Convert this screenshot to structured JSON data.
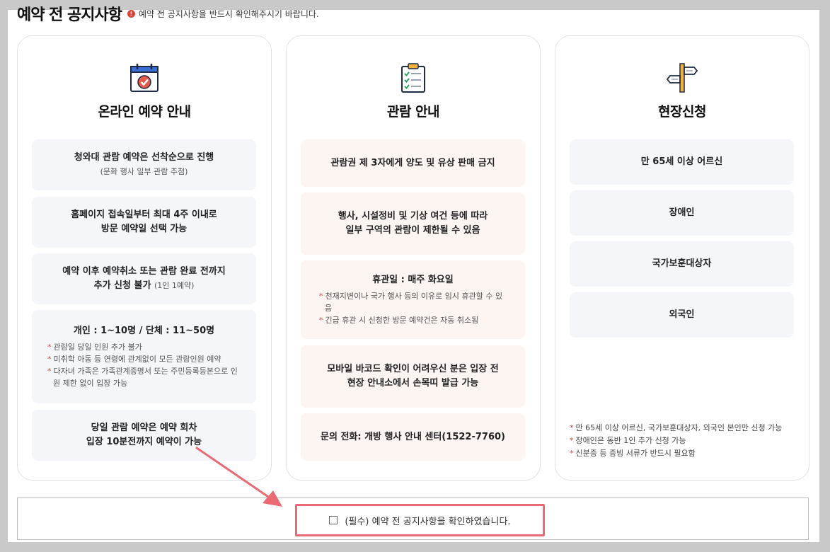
{
  "header": {
    "title": "예약 전 공지사항",
    "notice_icon": "!",
    "notice": "예약 전 공지사항을 반드시 확인해주시기 바랍니다."
  },
  "cards": [
    {
      "icon": "calendar-check-icon",
      "title": "온라인 예약 안내",
      "boxes": [
        {
          "text": "청와대 관람 예약은 선착순으로 진행",
          "sub": "(문화 행사 일부 관람 추첨)"
        },
        {
          "line1": "홈페이지 접속일부터 최대 4주 이내로",
          "line2": "방문 예약일 선택 가능"
        },
        {
          "line1": "예약 이후 예약취소 또는 관람 완료 전까지",
          "line2": "추가 신청 불가",
          "sub": "(1인 1예약)"
        },
        {
          "text": "개인 : 1~10명 / 단체 : 11~50명",
          "notes": [
            "관람일 당일 인원 추가 불가",
            "미취학 아동 등 연령에 관계없이 모든 관람인원 예약",
            "다자녀 가족은 가족관계증명서 또는 주민등록등본으로 인원 제한 없이 입장 가능"
          ]
        },
        {
          "line1": "당일 관람 예약은 예약 회차",
          "line2": "입장 10분전까지 예약이 가능"
        }
      ]
    },
    {
      "icon": "clipboard-checklist-icon",
      "title": "관람 안내",
      "boxes": [
        {
          "text": "관람권 제 3자에게 양도 및 유상 판매 금지"
        },
        {
          "line1": "행사, 시설정비 및 기상 여건 등에 따라",
          "line2": "일부 구역의 관람이 제한될 수 있음"
        },
        {
          "text": "휴관일 : 매주 화요일",
          "notes": [
            "천재지변이나 국가 행사 등의 이유로 임시 휴관할 수 있음",
            "긴급 휴관 시 신청한 방문 예약건은 자동 취소됨"
          ]
        },
        {
          "line1": "모바일 바코드 확인이 어려우신 분은 입장 전",
          "line2": "현장 안내소에서 손목띠 발급 가능"
        },
        {
          "text": "문의 전화: 개방 행사 안내 센터(1522-7760)"
        }
      ]
    },
    {
      "icon": "signpost-icon",
      "title": "현장신청",
      "boxes": [
        {
          "text": "만 65세 이상 어르신"
        },
        {
          "text": "장애인"
        },
        {
          "text": "국가보훈대상자"
        },
        {
          "text": "외국인"
        }
      ],
      "notes": [
        "만 65세 이상 어르신, 국가보훈대상자, 외국인 본인만 신청 가능",
        "장애인은 동반 1인 추가 신청 가능",
        "신분증 등 증빙 서류가 반드시 필요함"
      ]
    }
  ],
  "confirm": {
    "label": "(필수) 예약 전 공지사항을 확인하였습니다.",
    "checked": false
  },
  "colors": {
    "accent_red": "#d9453a",
    "highlight_border": "#e96a73",
    "box_blue": "#f4f6fa",
    "box_peach": "#fcf5f1"
  }
}
